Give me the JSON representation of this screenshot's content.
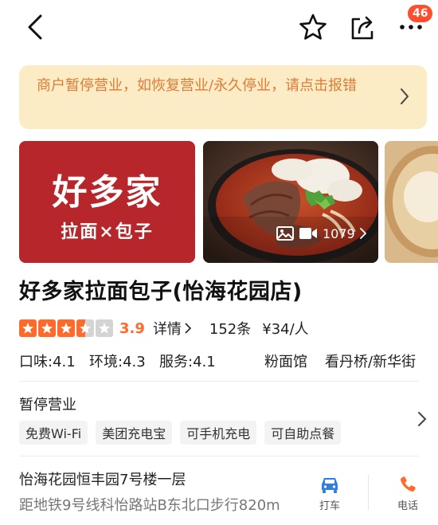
{
  "header": {
    "badge_count": "46",
    "icons": [
      "back-arrow-icon",
      "star-outline-icon",
      "share-icon",
      "more-dots-icon"
    ]
  },
  "notice": {
    "text": "商户暂停营业，如恢复营业/永久停业，请点击报错",
    "color": "#e07b35",
    "background": "#fbecc6"
  },
  "gallery": {
    "logo_title": "好多家",
    "logo_subtitle": "拉面×包子",
    "media_count": "1079",
    "logo_background": "#b7262b"
  },
  "store": {
    "name": "好多家拉面包子(怡海花园店)",
    "score": "3.9",
    "stars": 3.5,
    "details_label": "详情",
    "reviews": "152条",
    "price": "¥34/人",
    "accent": "#ff6a2b"
  },
  "metrics": {
    "taste": "口味:4.1",
    "environment": "环境:4.3",
    "service": "服务:4.1",
    "category": "粉面馆",
    "area": "看丹桥/新华街"
  },
  "status": {
    "title": "暂停营业",
    "tags": [
      "免费Wi-Fi",
      "美团充电宝",
      "可手机充电",
      "可自助点餐"
    ]
  },
  "address": {
    "line1": "怡海花园恒丰园7号楼一层",
    "line2": "距地铁9号线科怡路站B东北口步行820m",
    "taxi_label": "打车",
    "call_label": "电话",
    "taxi_color": "#2f7fe0",
    "call_color": "#ff6a2b"
  }
}
